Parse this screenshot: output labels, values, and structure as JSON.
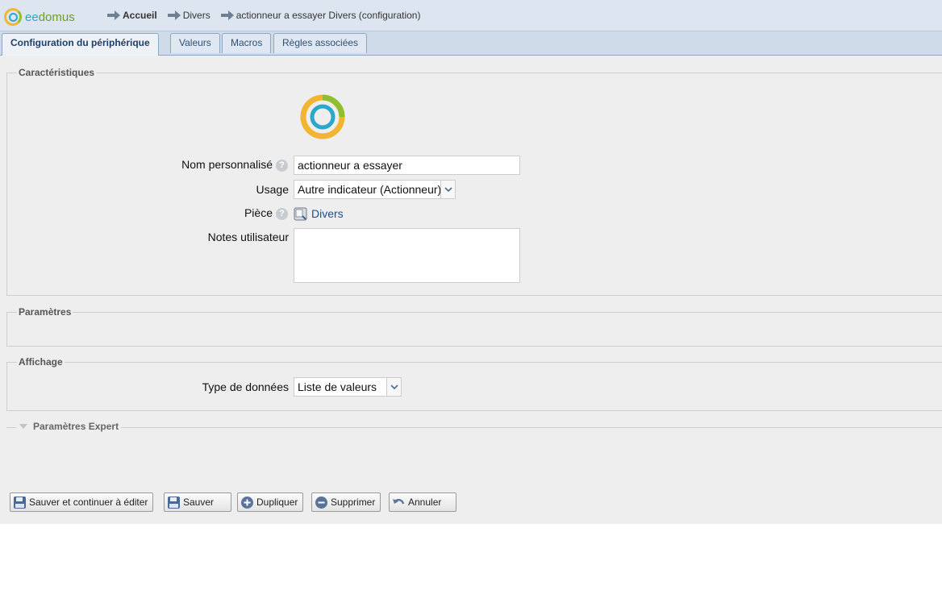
{
  "header": {
    "logo_text_a": "ee",
    "logo_text_b": "domus",
    "breadcrumbs": [
      "Accueil",
      "Divers",
      "actionneur a essayer Divers (configuration)"
    ]
  },
  "tabs": [
    "Configuration du périphérique",
    "Valeurs",
    "Macros",
    "Règles associées"
  ],
  "sections": {
    "caracteristiques": {
      "legend": "Caractéristiques",
      "name_label": "Nom personnalisé",
      "name_value": "actionneur a essayer",
      "usage_label": "Usage",
      "usage_value": "Autre indicateur (Actionneur)",
      "piece_label": "Pièce",
      "piece_value": "Divers",
      "notes_label": "Notes utilisateur",
      "notes_value": ""
    },
    "parametres": {
      "legend": "Paramètres"
    },
    "affichage": {
      "legend": "Affichage",
      "type_label": "Type de données",
      "type_value": "Liste de valeurs"
    },
    "expert": {
      "legend": "Paramètres Expert"
    }
  },
  "buttons": {
    "save_continue": "Sauver et continuer à éditer",
    "save": "Sauver",
    "duplicate": "Dupliquer",
    "delete": "Supprimer",
    "cancel": "Annuler"
  },
  "colors": {
    "accent_blue": "#2aa7c9",
    "accent_yellow": "#f2b531",
    "accent_green": "#8fbf2f",
    "link": "#1a4e9a"
  },
  "icons": {
    "help": "?"
  }
}
